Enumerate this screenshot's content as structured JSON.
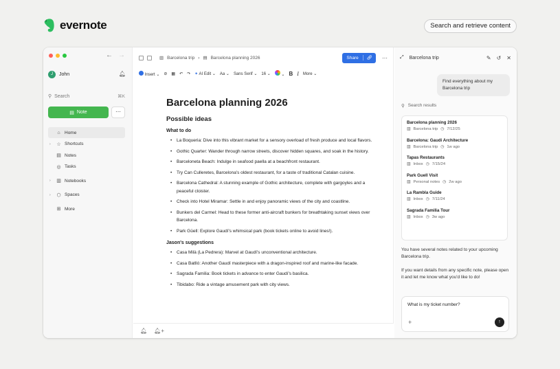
{
  "brand": {
    "name": "evernote",
    "accent": "#00a82d"
  },
  "top_pill": "Search and retrieve content",
  "sidebar": {
    "user": "John",
    "user_initial": "J",
    "search_placeholder": "Search",
    "search_shortcut": "⌘K",
    "note_button": "Note",
    "items": [
      {
        "label": "Home",
        "icon": "home-icon",
        "caret": false
      },
      {
        "label": "Shortcuts",
        "icon": "star-icon",
        "caret": true
      },
      {
        "label": "Notes",
        "icon": "notes-icon",
        "caret": false
      },
      {
        "label": "Tasks",
        "icon": "tasks-icon",
        "caret": false
      },
      {
        "label": "Notebooks",
        "icon": "notebook-icon",
        "caret": true
      },
      {
        "label": "Spaces",
        "icon": "spaces-icon",
        "caret": true
      },
      {
        "label": "More",
        "icon": "grid-icon",
        "caret": false
      }
    ]
  },
  "editor": {
    "breadcrumb": {
      "notebook": "Barcelona trip",
      "note": "Barcelona planning 2026"
    },
    "share_label": "Share",
    "toolbar": {
      "insert": "Insert",
      "ai_edit": "AI Edit",
      "font_style": "Aa",
      "font": "Sans Serif",
      "size": "16",
      "bold": "B",
      "italic": "I",
      "more": "More"
    },
    "title": "Barcelona planning 2026",
    "section": "Possible ideas",
    "groups": [
      {
        "heading": "What to do",
        "items": [
          "La Boqueria: Dive into this vibrant market for a sensory overload of fresh produce and local flavors.",
          "Gothic Quarter: Wander through narrow streets, discover hidden squares, and soak in the history.",
          "Barceloneta Beach: Indulge in seafood paella at a beachfront restaurant.",
          "Try Can Culleretes, Barcelona's oldest restaurant, for a taste of traditional Catalan cuisine.",
          "Barcelona Cathedral: A stunning example of Gothic architecture, complete with gargoyles and a peaceful cloister.",
          "Check into Hotel Miramar: Settle in and enjoy panoramic views of the city and coastline.",
          "Bunkers del Carmel: Head to these former anti-aircraft bunkers for breathtaking sunset views over Barcelona.",
          "Park Güell: Explore Gaudí's whimsical park (book tickets online to avoid lines!)."
        ]
      },
      {
        "heading": "Jason's suggestions",
        "items": [
          "Casa Milà (La Pedrera): Marvel at Gaudí's unconventional architecture.",
          "Casa Batlló: Another Gaudí masterpiece with a dragon-inspired roof and marine-like facade.",
          "Sagrada Familia: Book tickets in advance to enter Gaudí's basilica.",
          "Tibidabo: Ride a vintage amusement park with city views."
        ]
      }
    ]
  },
  "panel": {
    "title": "Barcelona trip",
    "user_message": "Find everything about my Barcelona trip",
    "search_results_label": "Search results",
    "results": [
      {
        "title": "Barcelona planning 2026",
        "notebook": "Barcelona trip",
        "time": "7/12/25"
      },
      {
        "title": "Barcelona: Gaudi Architecture",
        "notebook": "Barcelona trip",
        "time": "1w ago"
      },
      {
        "title": "Tapas Restaurants",
        "notebook": "Inbox",
        "time": "7/15/24"
      },
      {
        "title": "Park Guell Visit",
        "notebook": "Personal notes",
        "time": "2w ago"
      },
      {
        "title": "La Rambla Guide",
        "notebook": "Inbox",
        "time": "7/11/24"
      },
      {
        "title": "Sagrada Familia Tour",
        "notebook": "Inbox",
        "time": "3w ago"
      }
    ],
    "answer_1": "You have several notes related to your upcoming Barcelona trip.",
    "answer_2": "If you want details from any specific note, please open it and let me know what you'd like to do!",
    "input_value": "What is my ticket number?"
  },
  "colors": {
    "note_button": "#44b64f",
    "share": "#2f6fe4",
    "traffic": [
      "#ff5f57",
      "#febc2e",
      "#28c840"
    ]
  }
}
